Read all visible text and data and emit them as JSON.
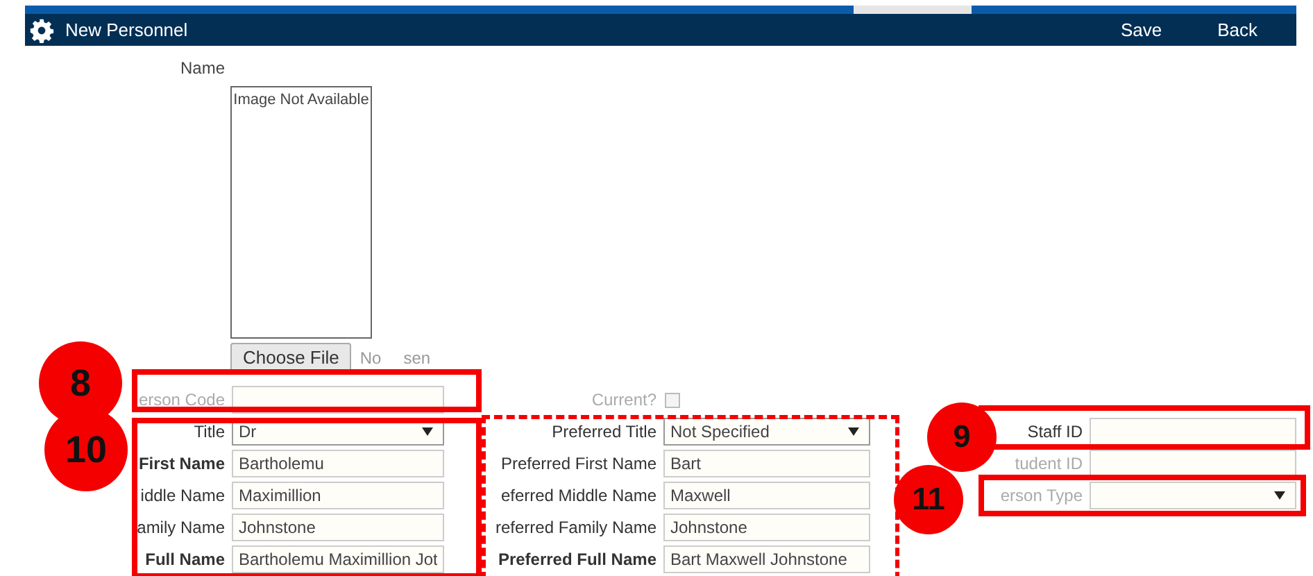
{
  "window": {
    "title": "New Personnel",
    "actions": [
      "Save",
      "Back"
    ]
  },
  "photo": {
    "section_label": "Name",
    "placeholder_text": "Image Not Available",
    "file_button": "Choose File",
    "file_status": [
      "No",
      "sen"
    ]
  },
  "columns": [
    {
      "fields": [
        {
          "label": "erson Code",
          "kind": "text",
          "bold": false,
          "disabled": true
        },
        {
          "label": "Title",
          "kind": "select",
          "value": "Dr",
          "bold": false,
          "disabled": false
        },
        {
          "label": "First Name",
          "kind": "text",
          "value": "Bartholemu",
          "bold": true,
          "disabled": false
        },
        {
          "label": "iddle Name",
          "kind": "text",
          "value": "Maximillion",
          "bold": false,
          "disabled": false
        },
        {
          "label": "amily Name",
          "kind": "text",
          "value": "Johnstone",
          "bold": false,
          "disabled": false
        },
        {
          "label": "Full Name",
          "kind": "text",
          "value": "Bartholemu Maximillion Jot",
          "bold": true,
          "disabled": false
        }
      ]
    },
    {
      "fields": [
        {
          "label": "Current?",
          "kind": "checkbox",
          "checked": false,
          "bold": false,
          "disabled": true
        },
        {
          "label": "Preferred Title",
          "kind": "select",
          "value": "Not Specified",
          "bold": false,
          "disabled": false
        },
        {
          "label": "Preferred First Name",
          "kind": "text",
          "value": "Bart",
          "bold": false,
          "disabled": false
        },
        {
          "label": "eferred Middle Name",
          "kind": "text",
          "value": "Maxwell",
          "bold": false,
          "disabled": false
        },
        {
          "label": "referred Family Name",
          "kind": "text",
          "value": "Johnstone",
          "bold": false,
          "disabled": false
        },
        {
          "label": "Preferred Full Name",
          "kind": "text",
          "value": "Bart Maxwell Johnstone",
          "bold": true,
          "disabled": false
        }
      ]
    },
    {
      "fields": [
        {
          "label": "Staff ID",
          "kind": "text",
          "bold": false,
          "disabled": false
        },
        {
          "label": "tudent ID",
          "kind": "text",
          "bold": false,
          "disabled": true
        },
        {
          "label": "erson Type",
          "kind": "select",
          "bold": false,
          "disabled": true
        }
      ]
    }
  ],
  "annotations": {
    "boxes": [
      {
        "kind": "solid"
      },
      {
        "kind": "solid"
      },
      {
        "kind": "dashed"
      },
      {
        "kind": "solid"
      },
      {
        "kind": "solid"
      }
    ],
    "markers": [
      "8",
      "10",
      "9",
      "11"
    ]
  }
}
